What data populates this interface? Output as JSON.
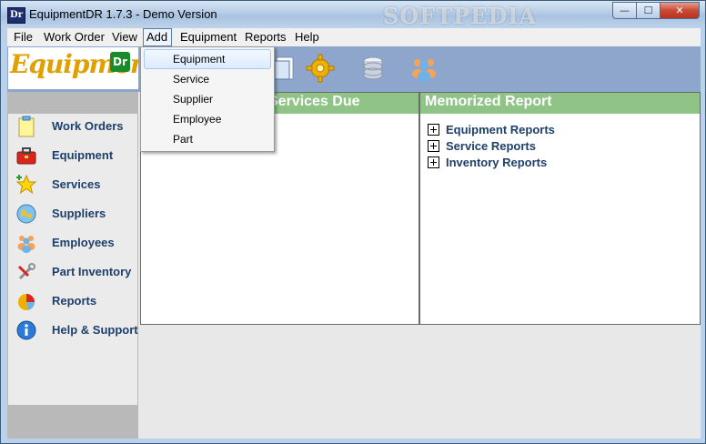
{
  "window": {
    "title": "EquipmentDR 1.7.3 - Demo Version",
    "app_icon_text": "Dr",
    "watermark": "SOFTPEDIA"
  },
  "title_buttons": {
    "minimize": "—",
    "maximize": "☐",
    "close": "✕"
  },
  "menubar": [
    "File",
    "Work Order",
    "View",
    "Add",
    "Equipment",
    "Reports",
    "Help"
  ],
  "active_menu": "Add",
  "add_menu": {
    "items": [
      "Equipment",
      "Service",
      "Supplier",
      "Employee",
      "Part"
    ],
    "hovered": "Equipment"
  },
  "logo": {
    "text": "Equipment",
    "badge": "Dr"
  },
  "toolbar_icons": [
    "document-icon",
    "gear-icon",
    "database-icon",
    "people-icon"
  ],
  "sidebar": {
    "items": [
      {
        "label": "Work Orders",
        "icon": "clipboard-icon"
      },
      {
        "label": "Equipment",
        "icon": "toolbox-icon"
      },
      {
        "label": "Services",
        "icon": "star-icon"
      },
      {
        "label": "Suppliers",
        "icon": "globe-icon"
      },
      {
        "label": "Employees",
        "icon": "people-icon"
      },
      {
        "label": "Part Inventory",
        "icon": "wrench-icon"
      },
      {
        "label": "Reports",
        "icon": "pie-chart-icon"
      },
      {
        "label": "Help & Support",
        "icon": "info-icon"
      }
    ]
  },
  "services_panel": {
    "title": "Services Due"
  },
  "report_panel": {
    "title": "Memorized Report",
    "items": [
      "Equipment Reports",
      "Service Reports",
      "Inventory Reports"
    ]
  },
  "colors": {
    "panel_header": "#8fc486",
    "toolbar": "#8ea6cb",
    "sidebar_text": "#1d3f6b"
  }
}
